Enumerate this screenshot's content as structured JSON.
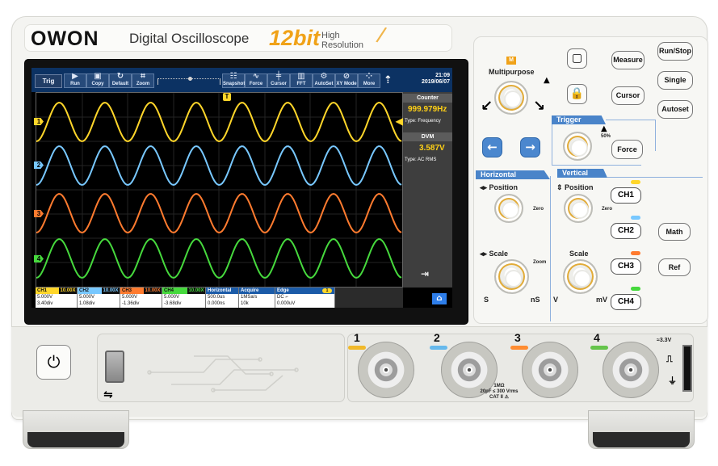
{
  "brand": {
    "logo": "OWON",
    "model": "Digital Oscilloscope",
    "bits": "12bit",
    "resolution_line_1": "High",
    "resolution_line_2": "Resolution",
    "colors": {
      "accent": "#f0a218",
      "panel_blue": "#4a84c9",
      "ch1": "#ffd62a",
      "ch2": "#78c8ff",
      "ch3": "#ff7b2f",
      "ch4": "#46d93d"
    }
  },
  "screen": {
    "toolbar": {
      "trig": "Trig",
      "buttons": [
        {
          "label": "Run",
          "icon": "play-icon"
        },
        {
          "label": "Copy",
          "icon": "copy-icon"
        },
        {
          "label": "Default",
          "icon": "refresh-icon"
        },
        {
          "label": "Zoom",
          "icon": "zoom-icon"
        },
        {
          "label": "Snapshot",
          "icon": "snapshot-icon"
        },
        {
          "label": "Force",
          "icon": "wave-icon"
        },
        {
          "label": "Cursor",
          "icon": "cursor-icon"
        },
        {
          "label": "FFT",
          "icon": "fft-icon"
        },
        {
          "label": "AutoSet",
          "icon": "gear-icon"
        },
        {
          "label": "XY Mode",
          "icon": "xy-icon"
        },
        {
          "label": "More",
          "icon": "grid-icon"
        }
      ],
      "usb": "USB",
      "time": "21:09",
      "date": "2019/06/07"
    },
    "markers": {
      "trigger_top": "T",
      "ch1": "1",
      "ch2": "2",
      "ch3": "3",
      "ch4": "4",
      "trigger_level": "◀"
    },
    "counter": {
      "title": "Counter",
      "value": "999.979Hz",
      "type": "Type: Frequency"
    },
    "dvm": {
      "title": "DVM",
      "value": "3.587V",
      "type": "Type: AC RMS"
    },
    "channels": [
      {
        "name": "CH1",
        "attn": "10.00X",
        "volt": "5.000V",
        "div": "3.40div",
        "coupling": "="
      },
      {
        "name": "CH2",
        "attn": "10.00X",
        "volt": "5.000V",
        "div": "1.08div",
        "coupling": "="
      },
      {
        "name": "CH3",
        "attn": "10.00X",
        "volt": "5.000V",
        "div": "-1.36div",
        "coupling": "="
      },
      {
        "name": "CH4",
        "attn": "10.00X",
        "volt": "5.000V",
        "div": "-3.68div",
        "coupling": "="
      }
    ],
    "horizontal": {
      "title": "Horizontal",
      "time": "500.0us",
      "position": "0.000ns"
    },
    "acquire": {
      "title": "Acquire",
      "rate": "1MSa/s",
      "depth": "10k"
    },
    "trigger": {
      "title": "Edge",
      "source": "1",
      "mode": "DC ⌐",
      "level": "0.000uV"
    }
  },
  "controls": {
    "multipurpose_marker": "M",
    "multipurpose": "Multipurpose",
    "trigger_title": "Trigger",
    "trigger_percent": "50%",
    "horizontal_title": "Horizontal",
    "vertical_title": "Vertical",
    "position": "Position",
    "scale": "Scale",
    "zero": "Zero",
    "zoom": "Zoom",
    "s": "S",
    "ns": "nS",
    "v": "V",
    "mv": "mV",
    "buttons": {
      "measure": "Measure",
      "cursor": "Cursor",
      "run_stop": "Run/Stop",
      "single": "Single",
      "autoset": "Autoset",
      "force": "Force",
      "ch1": "CH1",
      "ch2": "CH2",
      "ch3": "CH3",
      "ch4": "CH4",
      "math": "Math",
      "ref": "Ref"
    }
  },
  "front": {
    "inputs": [
      "1",
      "2",
      "3",
      "4"
    ],
    "calibration": "≈3.3V",
    "warning_line_1": "1MΩ",
    "warning_line_2": "20pF ≤ 300 Vrms",
    "warning_line_3": "CAT II ⚠"
  }
}
